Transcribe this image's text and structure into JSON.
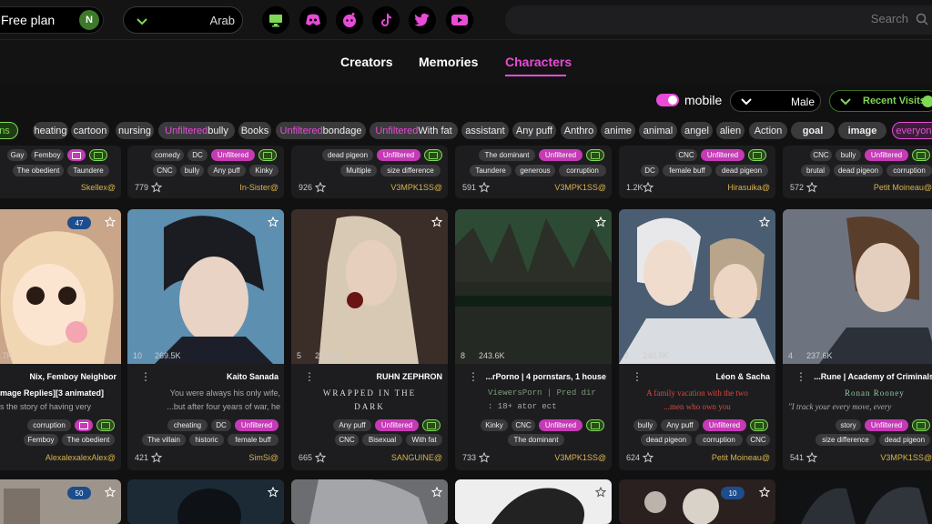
{
  "header": {
    "plan_label": "Free plan",
    "avatar_initial": "N",
    "language": "Arab",
    "search_placeholder": "Search",
    "socials": [
      "monitor-icon",
      "discord-icon",
      "reddit-icon",
      "tiktok-icon",
      "twitter-icon",
      "youtube-icon"
    ]
  },
  "tabs": [
    {
      "label": "Creators",
      "active": false
    },
    {
      "label": "Memories",
      "active": false
    },
    {
      "label": "Characters",
      "active": true
    }
  ],
  "filters": {
    "mobile_label": "mobile",
    "gender": "Male",
    "sort": "Recent Visits"
  },
  "tag_chips": [
    "ns",
    "heating",
    "cartoon",
    "nursing",
    "Unfiltered",
    "bully",
    "Books",
    "Unfiltered",
    "bondage",
    "Unfiltered",
    "With fat",
    "assistant",
    "Any puff",
    "Anthro",
    "anime",
    "animal",
    "angel",
    "alien",
    "Action",
    "goal",
    "image",
    "everyone"
  ],
  "row1": [
    {
      "tags": [
        "Gay",
        "Femboy",
        "The obedient",
        "Taundere"
      ],
      "likes": "",
      "author": "Skellex@"
    },
    {
      "tags": [
        "comedy",
        "DC",
        "Unfiltered",
        "CNC",
        "bully",
        "Any puff",
        "Kinky"
      ],
      "likes": "779",
      "author": "In-Sister@"
    },
    {
      "tags": [
        "dead pigeon",
        "Unfiltered",
        "Multiple",
        "size difference"
      ],
      "likes": "926",
      "author": "V3MPK1SS@"
    },
    {
      "tags": [
        "The dominant",
        "Unfiltered",
        "Taundere",
        "generous",
        "corruption"
      ],
      "likes": "591",
      "author": "V3MPK1SS@"
    },
    {
      "tags": [
        "CNC",
        "Unfiltered",
        "DC",
        "female buff",
        "dead pigeon"
      ],
      "likes": "1.2K",
      "author": "Hirasuika@"
    },
    {
      "tags": [
        "CNC",
        "bully",
        "Unfiltered",
        "brutal",
        "dead pigeon",
        "corruption"
      ],
      "likes": "572",
      "author": "Petit Moineau@"
    }
  ],
  "row2": [
    {
      "badge": "47",
      "stats_msgs": "",
      "stats_views": ".7K",
      "title": "Nix, Femboy Neighbor",
      "desc1": "mage Replies][3 animated]",
      "desc2": "s the story of having very",
      "tags": [
        "corruption",
        "Femboy",
        "The obedient"
      ],
      "likes": "",
      "author": "AlexalexalexAlex@"
    },
    {
      "badge": "",
      "stats_msgs": "10",
      "stats_views": "269.5K",
      "title": "Kaito Sanada",
      "desc1": "You were always his only wife,",
      "desc2": "...but after four years of war, he",
      "tags": [
        "cheating",
        "DC",
        "Unfiltered",
        "The villain",
        "historic",
        "female buff"
      ],
      "likes": "421",
      "author": "SimSi@"
    },
    {
      "badge": "",
      "stats_msgs": "5",
      "stats_views": "250.5K",
      "title": "RUHN ZEPHRON",
      "desc1": "WRAPPED IN THE",
      "desc2": "DARK",
      "tags": [
        "Any puff",
        "Unfiltered",
        "CNC",
        "Bisexual",
        "With fat"
      ],
      "likes": "665",
      "author": "SANGUINE@"
    },
    {
      "badge": "",
      "stats_msgs": "8",
      "stats_views": "243.6K",
      "title": "...rPorno | 4 pornstars, 1 house",
      "desc1": "ViewersPorn | Pred dir",
      "desc2": ": 18+    ator ect",
      "tags": [
        "Kinky",
        "CNC",
        "Unfiltered",
        "The dominant",
        "V3MPK1SS"
      ],
      "likes": "733",
      "author": "V3MPK1SS@"
    },
    {
      "badge": "",
      "stats_msgs": "2",
      "stats_views": "240.5K",
      "title": "Léon & Sacha",
      "desc1": "A family vacation with the two",
      "desc2": "...men who own you",
      "tags": [
        "bully",
        "Any puff",
        "Unfiltered",
        "dead pigeon",
        "corruption",
        "CNC"
      ],
      "likes": "624",
      "author": "Petit Moineau@"
    },
    {
      "badge": "",
      "stats_msgs": "4",
      "stats_views": "237.6K",
      "title": "...Rune | Academy of Criminals",
      "desc1": "Ronan Rooney",
      "desc2": "\"I track your every move, every",
      "tags": [
        "story",
        "Unfiltered",
        "size difference",
        "dead pigeon"
      ],
      "likes": "541",
      "author": "V3MPK1SS@"
    }
  ],
  "row3_badges": [
    "50",
    "",
    "",
    "",
    "10",
    ""
  ]
}
